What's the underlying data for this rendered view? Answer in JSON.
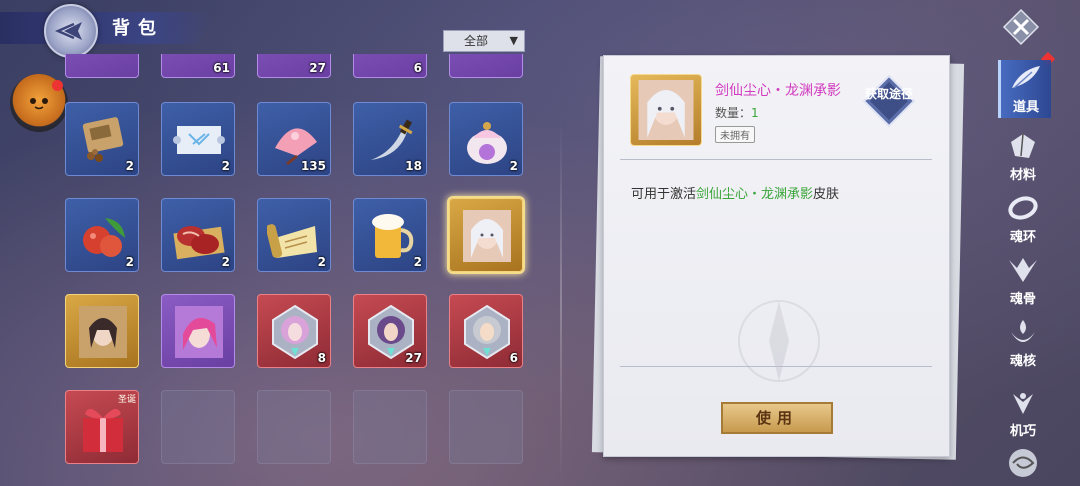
{
  "header": {
    "title": "背包"
  },
  "filter": {
    "selected": "全部"
  },
  "grid": {
    "row0": [
      {
        "rarity": "purple",
        "count": ""
      },
      {
        "rarity": "purple",
        "count": "61"
      },
      {
        "rarity": "purple",
        "count": "27"
      },
      {
        "rarity": "purple",
        "count": "6"
      },
      {
        "rarity": "purple",
        "count": ""
      }
    ],
    "row1": [
      {
        "rarity": "blue",
        "count": "2",
        "icon": "seed-bag-icon"
      },
      {
        "rarity": "blue",
        "count": "2",
        "icon": "scroll-map-icon"
      },
      {
        "rarity": "blue",
        "count": "135",
        "icon": "fan-icon"
      },
      {
        "rarity": "blue",
        "count": "18",
        "icon": "dagger-icon"
      },
      {
        "rarity": "blue",
        "count": "2",
        "icon": "pouch-icon"
      }
    ],
    "row2": [
      {
        "rarity": "blue",
        "count": "2",
        "icon": "fruit-icon"
      },
      {
        "rarity": "blue",
        "count": "2",
        "icon": "meat-icon"
      },
      {
        "rarity": "blue",
        "count": "2",
        "icon": "scroll-icon"
      },
      {
        "rarity": "blue",
        "count": "2",
        "icon": "beer-icon"
      },
      {
        "rarity": "gold",
        "count": "",
        "icon": "skin-card-icon"
      }
    ],
    "row3": [
      {
        "rarity": "gold",
        "count": "",
        "icon": "skin-card-icon"
      },
      {
        "rarity": "purple",
        "count": "",
        "icon": "skin-card-icon"
      },
      {
        "rarity": "red",
        "count": "8",
        "icon": "soul-emblem-icon"
      },
      {
        "rarity": "red",
        "count": "27",
        "icon": "soul-emblem-icon"
      },
      {
        "rarity": "red",
        "count": "6",
        "icon": "soul-emblem-icon"
      }
    ],
    "row4": [
      {
        "rarity": "red",
        "count": "",
        "icon": "gift-box-icon",
        "tag": "圣诞"
      }
    ]
  },
  "detail": {
    "name": "剑仙尘心・龙渊承影",
    "qty_label": "数量：",
    "qty_value": "1",
    "owned_status": "未拥有",
    "acquire_label": "获取途径",
    "desc_prefix": "可用于激活",
    "desc_highlight": "剑仙尘心・龙渊承影",
    "desc_suffix": "皮肤",
    "use_button": "使用"
  },
  "nav": {
    "items": [
      {
        "label": "道具",
        "icon": "feather-icon",
        "active": true
      },
      {
        "label": "材料",
        "icon": "crystal-icon",
        "active": false
      },
      {
        "label": "魂环",
        "icon": "ring-icon",
        "active": false
      },
      {
        "label": "魂骨",
        "icon": "bone-wing-icon",
        "active": false
      },
      {
        "label": "魂核",
        "icon": "core-icon",
        "active": false
      },
      {
        "label": "机巧",
        "icon": "mechanism-icon",
        "active": false
      }
    ]
  },
  "colors": {
    "rarity_blue": "#3e5fa8",
    "rarity_purple": "#8a5cc4",
    "rarity_gold": "#d9a845",
    "rarity_red": "#c64a52",
    "item_name": "#d13bbf",
    "highlight_green": "#3aa53a"
  }
}
